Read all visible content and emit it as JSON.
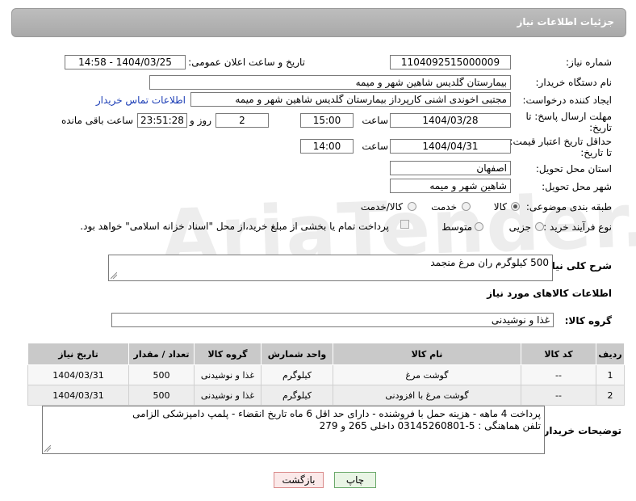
{
  "header": {
    "title": "جزئیات اطلاعات نیاز"
  },
  "form": {
    "need_number_label": "شماره نیاز:",
    "need_number": "1104092515000009",
    "announce_label": "تاریخ و ساعت اعلان عمومی:",
    "announce_value": "1404/03/25 - 14:58",
    "buyer_org_label": "نام دستگاه خریدار:",
    "buyer_org": "بیمارستان گلدیس  شاهین شهر و میمه",
    "requester_label": "ایجاد کننده درخواست:",
    "requester": "مجتبی اخوندی اشنی کارپرداز بیمارستان گلدیس  شاهین شهر و میمه",
    "contact_link": "اطلاعات تماس خریدار",
    "deadline_label_1": "مهلت ارسال پاسخ: تا",
    "deadline_label_2": "تاریخ:",
    "deadline_date": "1404/03/28",
    "time_label": "ساعت",
    "deadline_time": "15:00",
    "days_value": "2",
    "days_label": "روز و",
    "remaining_time": "23:51:28",
    "remaining_label": "ساعت باقی مانده",
    "validity_label_1": "حداقل تاریخ اعتبار قیمت:",
    "validity_label_2": "تا تاریخ:",
    "validity_date": "1404/04/31",
    "validity_time": "14:00",
    "province_label": "استان محل تحویل:",
    "province": "اصفهان",
    "city_label": "شهر محل تحویل:",
    "city": "شاهین شهر و میمه",
    "category_label": "طبقه بندی موضوعی:",
    "category_options": [
      "کالا",
      "خدمت",
      "کالا/خدمت"
    ],
    "process_label": "نوع فرآیند خرید :",
    "process_options": [
      "جزیی",
      "متوسط"
    ],
    "payment_note": "پرداخت تمام یا بخشی از مبلغ خرید،از محل \"اسناد خزانه اسلامی\" خواهد بود."
  },
  "summary": {
    "label": "شرح کلی نیاز:",
    "value": "500 کیلوگرم ران مرغ منجمد"
  },
  "goods_section_title": "اطلاعات کالاهای مورد نیاز",
  "goods_group": {
    "label": "گروه کالا:",
    "value": "غذا و نوشیدنی"
  },
  "table": {
    "headers": [
      "ردیف",
      "کد کالا",
      "نام کالا",
      "واحد شمارش",
      "گروه کالا",
      "تعداد / مقدار",
      "تاریخ نیاز"
    ],
    "rows": [
      [
        "1",
        "--",
        "گوشت مرغ",
        "کیلوگرم",
        "غذا و نوشیدنی",
        "500",
        "1404/03/31"
      ],
      [
        "2",
        "--",
        "گوشت مرغ با افزودنی",
        "کیلوگرم",
        "غذا و نوشیدنی",
        "500",
        "1404/03/31"
      ]
    ]
  },
  "buyer_notes": {
    "label": "توضیحات خریدار:",
    "line1": "پرداخت 4 ماهه - هزینه حمل با فروشنده - دارای حد اقل 6 ماه تاریخ انقضاء - پلمپ دامپزشکی الزامی",
    "line2": "تلفن هماهنگی : 5-03145260801 داخلی 265 و 279"
  },
  "buttons": {
    "print": "چاپ",
    "back": "بازگشت"
  },
  "watermark": "AriaTender.neT"
}
